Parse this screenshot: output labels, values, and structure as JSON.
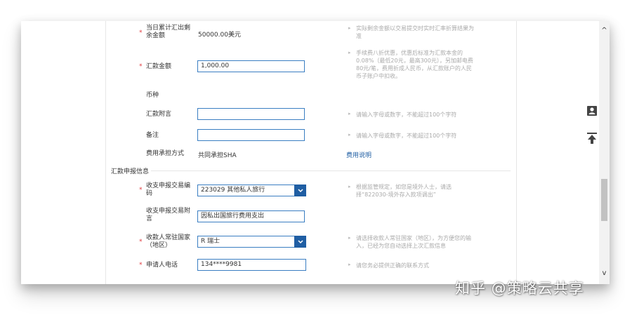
{
  "form": {
    "balance": {
      "label_line1": "当日累计汇出剩",
      "label_line2": "余金额",
      "value": "50000.00美元",
      "hint_line1": "实际剩余金额以交易提交时实时汇率折算结果为",
      "hint_line2": "准"
    },
    "amount": {
      "label": "汇款金额",
      "value": "1,000.00",
      "hint_lines": [
        "手续费八折优惠，优惠后标准为汇款本金的",
        "0.08%（最低20元，最高300元），另加邮电费",
        "80元/笔，费用折成人民币，从汇款账户的人民",
        "币子账户中扣收。"
      ]
    },
    "currency": {
      "label": "币种"
    },
    "remark_attach": {
      "label": "汇款附言",
      "value": "",
      "hint": "请输入字母或数字，不能超过100个字符"
    },
    "note": {
      "label": "备注",
      "value": "",
      "hint": "请输入字母或数字，不能超过100个字符"
    },
    "fee_mode": {
      "label": "费用承担方式",
      "value": "共同承担SHA",
      "link": "费用说明"
    },
    "section_title": "汇款申报信息",
    "trade_code": {
      "label_line1": "收支申报交易编",
      "label_line2": "码",
      "value": "223029 其他私人旅行",
      "hint_line1": "根据监管规定，如您是境外人士，请选",
      "hint_line2": "择“822030-境外存入款项调出”"
    },
    "trade_attach": {
      "label_line1": "收支申报交易附",
      "label_line2": "言",
      "value": "因私出国旅行费用支出"
    },
    "country": {
      "label_line1": "收款人常驻国家",
      "label_line2": "（地区）",
      "value": "R 瑞士",
      "hint_line1": "请选择收款人常驻国家（地区），为方便您的输",
      "hint_line2": "入，已经为您自动选择上次汇款信息"
    },
    "phone": {
      "label": "申请人电话",
      "value": "134****9981",
      "hint": "请您务必提供正确的联系方式"
    }
  },
  "required_mark": "*",
  "hint_arrow": "▸",
  "sidebar": {
    "icons": [
      "contact-card-icon",
      "back-to-top-icon"
    ]
  },
  "scrollbar": {
    "up": "^",
    "down": "v"
  },
  "watermark": "知乎 @策略云共享",
  "colors": {
    "accent": "#1f5ea3",
    "required": "#e0393e",
    "input_border": "#3a7ec2",
    "hint": "#aaaaaa"
  }
}
